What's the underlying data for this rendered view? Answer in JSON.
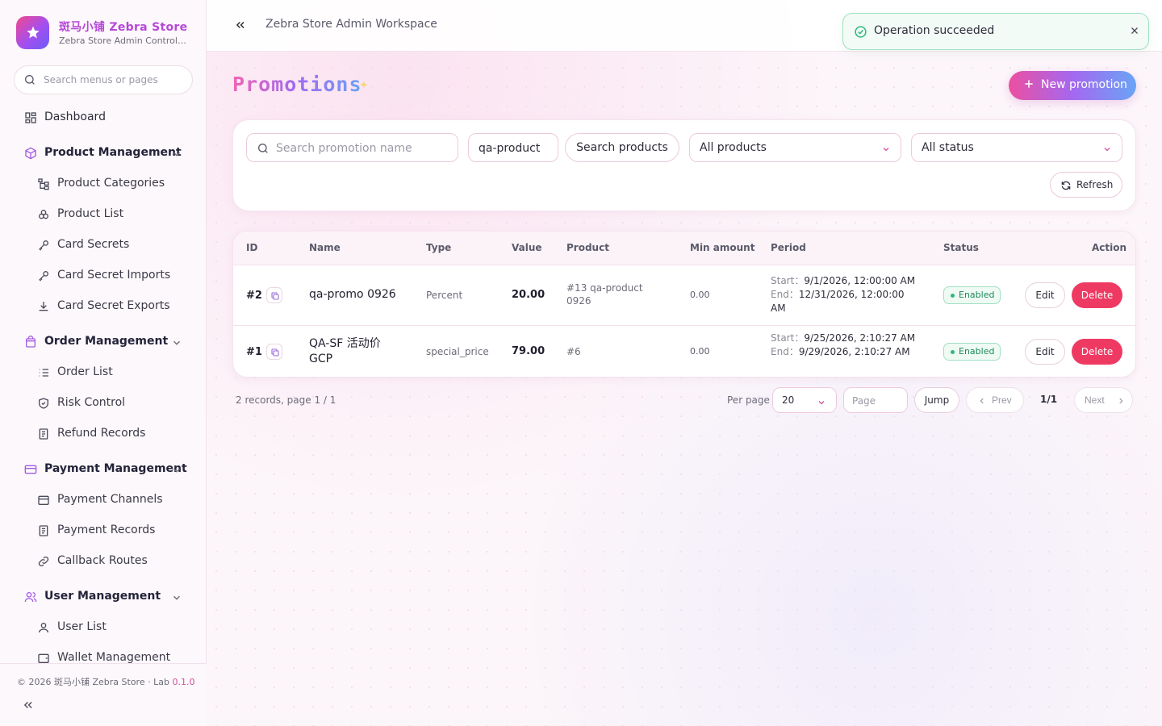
{
  "brand": {
    "title": "斑马小铺 Zebra Store",
    "subtitle": "Zebra Store Admin Control Panel"
  },
  "sidebar": {
    "search_placeholder": "Search menus or pages",
    "dashboard": "Dashboard",
    "groups": [
      {
        "label": "Product Management",
        "items": [
          "Product Categories",
          "Product List",
          "Card Secrets",
          "Card Secret Imports",
          "Card Secret Exports"
        ]
      },
      {
        "label": "Order Management",
        "items": [
          "Order List",
          "Risk Control",
          "Refund Records"
        ]
      },
      {
        "label": "Payment Management",
        "items": [
          "Payment Channels",
          "Payment Records",
          "Callback Routes"
        ]
      },
      {
        "label": "User Management",
        "items": [
          "User List",
          "Wallet Management"
        ]
      }
    ],
    "footer_copy": "© 2026 斑马小铺 Zebra Store · Lab",
    "footer_version": "0.1.0"
  },
  "topbar": {
    "workspace": "Zebra Store Admin Workspace"
  },
  "toast": {
    "message": "Operation succeeded",
    "status_color": "#2eb97a"
  },
  "page": {
    "title": "Promotions",
    "new_button": "New promotion"
  },
  "filters": {
    "name_placeholder": "Search promotion name",
    "product_search_value": "qa-product",
    "search_products_button": "Search products",
    "product_select": "All products",
    "status_select": "All status",
    "refresh_button": "Refresh"
  },
  "table": {
    "headers": [
      "ID",
      "Name",
      "Type",
      "Value",
      "Product",
      "Min amount",
      "Period",
      "Status",
      "Action"
    ],
    "rows": [
      {
        "id": "#2",
        "name": "qa-promo 0926",
        "type": "Percent",
        "value": "20.00",
        "product_line1": "#13 qa-product",
        "product_line2": "0926",
        "min_amount": "0.00",
        "start_label": "Start：",
        "start": "9/1/2026, 12:00:00 AM",
        "end_label": "End：",
        "end_line1": "12/31/2026, 12:00:00",
        "end_line2": "AM",
        "status": "Enabled",
        "edit": "Edit",
        "delete": "Delete"
      },
      {
        "id": "#1",
        "name_line1": "QA-SF 活动价",
        "name_line2": "GCP",
        "type": "special_price",
        "value": "79.00",
        "product_line1": "#6",
        "min_amount": "0.00",
        "start_label": "Start：",
        "start": "9/25/2026, 2:10:27 AM",
        "end_label": "End：",
        "end": "9/29/2026, 2:10:27 AM",
        "status": "Enabled",
        "edit": "Edit",
        "delete": "Delete"
      }
    ]
  },
  "pagination": {
    "summary": "2 records, page 1 / 1",
    "per_page_label": "Per page",
    "per_page_value": "20",
    "page_placeholder": "Page",
    "jump": "Jump",
    "prev": "Prev",
    "current": "1/1",
    "next": "Next"
  },
  "colors": {
    "accent_pink": "#ec4fa0",
    "accent_purple": "#a468f0",
    "danger": "#ee3a63",
    "success": "#2eb97a"
  }
}
